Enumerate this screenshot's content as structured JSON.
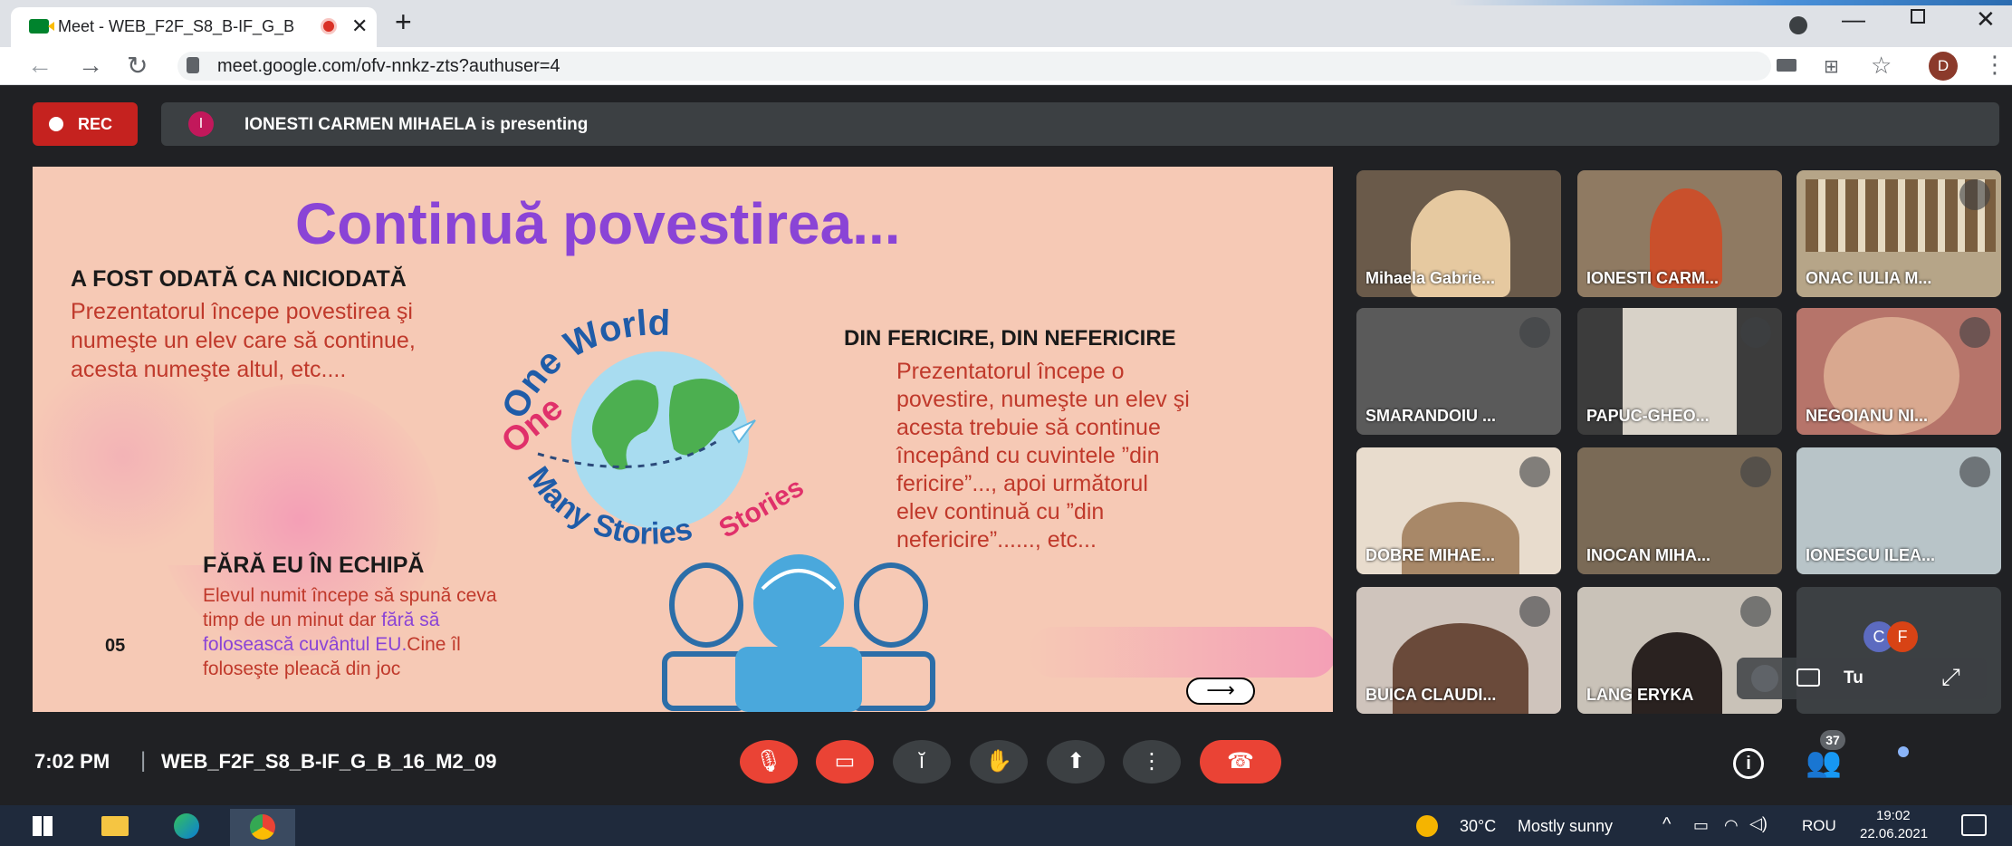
{
  "browser": {
    "tab_title": "Meet - WEB_F2F_S8_B-IF_G_B",
    "url": "meet.google.com/ofv-nnkz-zts?authuser=4",
    "profile_initial": "D"
  },
  "meeting": {
    "rec_label": "REC",
    "presenter_initial": "I",
    "presenting_text": "IONESTI CARMEN MIHAELA is presenting",
    "time": "7:02 PM",
    "separator": "|",
    "code": "WEB_F2F_S8_B-IF_G_B_16_M2_09",
    "participant_count": "37"
  },
  "slide": {
    "title": "Continuă povestirea...",
    "s1_heading": "A FOST ODATĂ CA NICIODATĂ",
    "s1_body": [
      "Prezentatorul începe povestirea şi",
      "numeşte un elev care să continue,",
      "acesta numeşte altul, etc...."
    ],
    "s2_heading": "DIN FERICIRE, DIN NEFERICIRE",
    "s2_body": [
      "Prezentatorul începe o",
      "povestire, numeşte un elev şi",
      "acesta trebuie să continue",
      "începând cu cuvintele ”din",
      "fericire”..., apoi următorul",
      "elev continuă cu ”din",
      "nefericire”......, etc..."
    ],
    "s3_heading": "FĂRĂ EU ÎN ECHIPĂ",
    "s3_line1": "Elevul numit începe să spună ceva",
    "s3_line2_a": "timp de un minut dar ",
    "s3_line2_b": "fără să",
    "s3_line3_a": "folosească cuvântul EU.",
    "s3_line3_b": "Cine îl",
    "s3_line4": "foloseşte pleacă din joc",
    "page_num": "05",
    "arrow": "⟶",
    "logo_top": "One World",
    "logo_bottom": "Many Stories"
  },
  "participants": [
    {
      "name": "Mihaela Gabrie...",
      "muted": false
    },
    {
      "name": "IONESTI CARM...",
      "muted": false
    },
    {
      "name": "ONAC IULIA M...",
      "muted": true
    },
    {
      "name": "SMARANDOIU ...",
      "muted": true
    },
    {
      "name": "PAPUC-GHEO...",
      "muted": true
    },
    {
      "name": "NEGOIANU NI...",
      "muted": true
    },
    {
      "name": "DOBRE MIHAE...",
      "muted": true
    },
    {
      "name": "INOCAN MIHA...",
      "muted": true
    },
    {
      "name": "IONESCU ILEA...",
      "muted": true
    },
    {
      "name": "BUICA CLAUDI...",
      "muted": true
    },
    {
      "name": "LANG ERYKA",
      "muted": true
    }
  ],
  "self_tile": {
    "avatar1": "C",
    "avatar2": "F",
    "label": "Tu"
  },
  "taskbar": {
    "temp": "30°C",
    "weather": "Mostly sunny",
    "lang": "ROU",
    "time": "19:02",
    "date": "22.06.2021"
  }
}
